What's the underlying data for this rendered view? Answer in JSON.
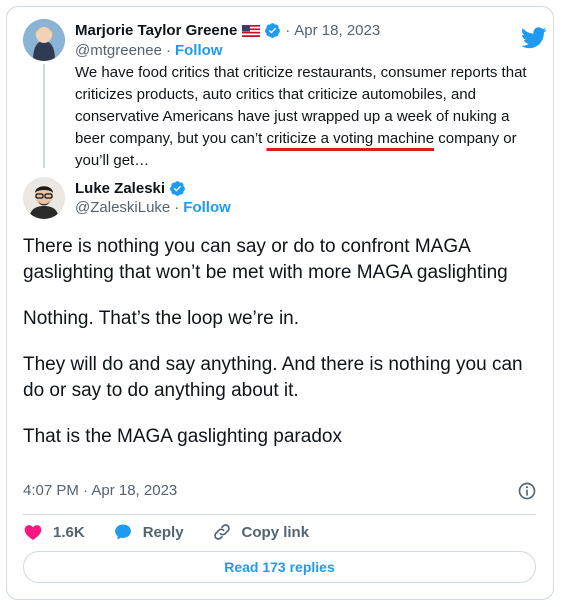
{
  "quoted": {
    "author_name": "Marjorie Taylor Greene",
    "flag_icon": "us-flag-icon",
    "handle": "@mtgreenee",
    "separator": "·",
    "date": "Apr 18, 2023",
    "follow_label": "Follow",
    "text_before": "We have food critics that criticize restaurants, consumer reports that criticizes products, auto critics that criticize automobiles, and conservative Americans have just wrapped up a week of nuking a beer company, but you can’t ",
    "text_underlined": "criticize a voting machine",
    "text_after": " company or you’ll get…"
  },
  "tweet": {
    "author_name": "Luke Zaleski",
    "handle": "@ZaleskiLuke",
    "separator": "·",
    "follow_label": "Follow",
    "paragraphs": [
      "There is nothing you can say or do to confront MAGA gaslighting that won’t be met with more MAGA gaslighting",
      "Nothing. That’s the loop we’re in.",
      "They will do and say anything. And there is nothing you can do or say to do anything about it.",
      "That is the MAGA gaslighting paradox"
    ],
    "timestamp": "4:07 PM · Apr 18, 2023"
  },
  "actions": {
    "likes_count": "1.6K",
    "reply_label": "Reply",
    "copy_link_label": "Copy link"
  },
  "read_replies_label": "Read 173 replies",
  "colors": {
    "brand_blue": "#1d9bf0",
    "heart_red": "#f91880",
    "underline_red": "#e0191f",
    "muted_gray": "#536471",
    "border_gray": "#cfd9de"
  }
}
